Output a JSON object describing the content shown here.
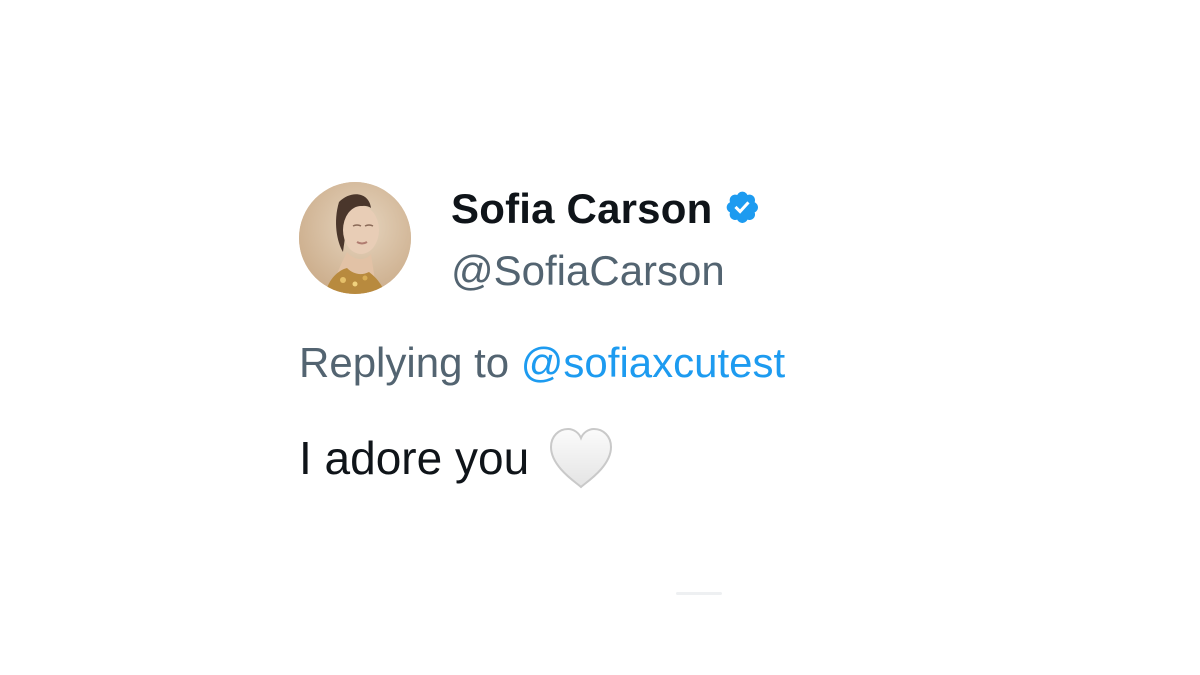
{
  "tweet": {
    "display_name": "Sofia Carson",
    "handle": "@SofiaCarson",
    "verified": true,
    "avatar_icon": "profile-photo",
    "reply_prefix": "Replying to",
    "reply_handle": "@sofiaxcutest",
    "body_text": "I adore you",
    "emoji_icon": "white-heart-icon"
  },
  "colors": {
    "name": "#0f1419",
    "secondary": "#536471",
    "link": "#1d9bf0",
    "verified_badge": "#1d9bf0",
    "background": "#ffffff"
  }
}
